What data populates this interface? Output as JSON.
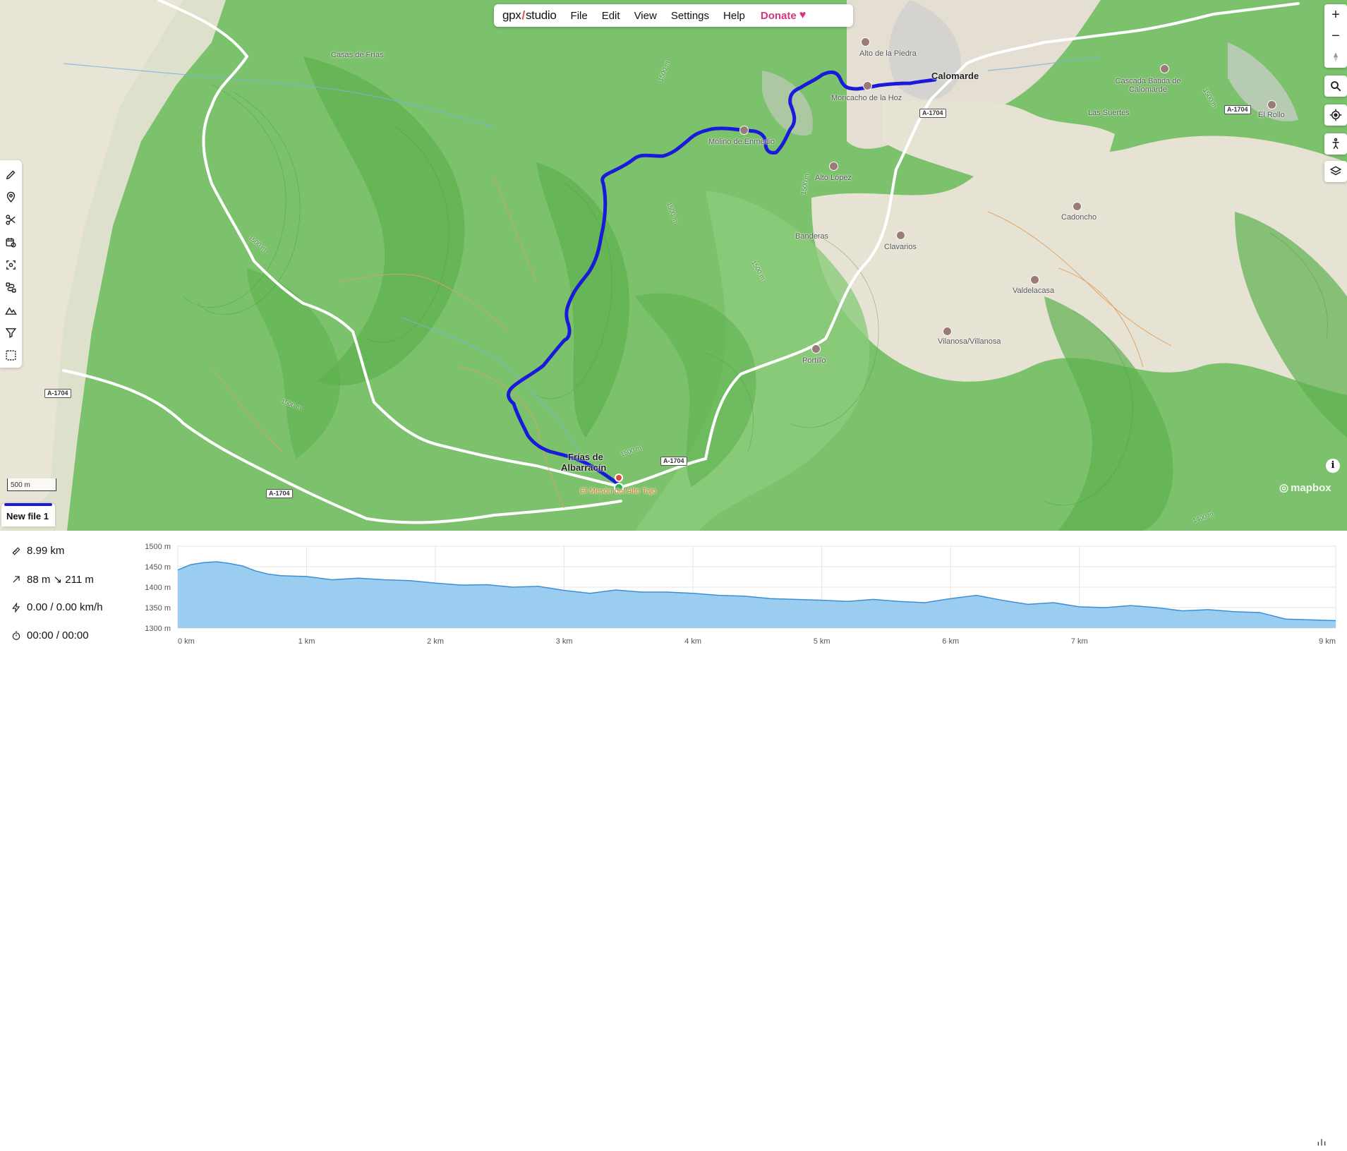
{
  "app": {
    "logo_left": "gpx",
    "logo_slash": "/",
    "logo_right": "studio"
  },
  "menu": {
    "file": "File",
    "edit": "Edit",
    "view": "View",
    "settings": "Settings",
    "help": "Help",
    "donate": "Donate"
  },
  "map": {
    "scale_label": "500 m",
    "attribution": "mapbox",
    "info": "i",
    "places": {
      "casas_de_frias": "Casas de Frías",
      "alto_de_la_piedra": "Alto de la Piedra",
      "calomarde": "Calomarde",
      "moricacho": "Moricacho de la Hoz",
      "molino": "Molino de Enmedio",
      "alto_lopez": "Alto López",
      "banderas": "Banderas",
      "clavarios": "Clavarios",
      "cascada": "Cascada Batida de Calomarde",
      "las_suertes": "Las Suertes",
      "el_rollo": "El Rollo",
      "cadoncho": "Cadoncho",
      "valdelacasa": "Valdelacasa",
      "vilanosa": "Vilanosa/Villanosa",
      "portillo": "Portillo",
      "frias_line1": "Frías de",
      "frias_line2": "Albarracín",
      "meson": "El Mesón del Alto Tajo"
    },
    "roads": {
      "r1": "A-1704",
      "r2": "A-1704",
      "r3": "A-1704",
      "r4": "A-1704",
      "r5": "A-1704"
    },
    "contours": {
      "c1": "1500 m",
      "c2": "1500 m",
      "c3": "1500 m",
      "c4": "1500 m",
      "c5": "1500 m",
      "c6": "1400 m",
      "c7": "1500 m",
      "c8": "1500 m",
      "c9": "1500 m"
    }
  },
  "file_tab": {
    "name": "New file 1",
    "color": "#1a1adb"
  },
  "stats": {
    "distance": "8.99 km",
    "elevation": "88 m ↘ 211 m",
    "speed": "0.00 / 0.00 km/h",
    "time": "00:00 / 00:00"
  },
  "chart_data": {
    "type": "area",
    "ylabel_ticks": [
      "1500 m",
      "1450 m",
      "1400 m",
      "1350 m",
      "1300 m"
    ],
    "xlabel_ticks": [
      "0 km",
      "1 km",
      "2 km",
      "3 km",
      "4 km",
      "5 km",
      "6 km",
      "7 km",
      "9 km"
    ],
    "ylim": [
      1300,
      1500
    ],
    "xlim": [
      0,
      8.99
    ],
    "x": [
      0,
      0.1,
      0.2,
      0.3,
      0.4,
      0.5,
      0.6,
      0.7,
      0.8,
      0.9,
      1.0,
      1.2,
      1.4,
      1.6,
      1.8,
      2.0,
      2.2,
      2.4,
      2.6,
      2.8,
      3.0,
      3.2,
      3.4,
      3.6,
      3.8,
      4.0,
      4.2,
      4.4,
      4.6,
      4.8,
      5.0,
      5.2,
      5.4,
      5.6,
      5.8,
      6.0,
      6.2,
      6.4,
      6.6,
      6.8,
      7.0,
      7.2,
      7.4,
      7.6,
      7.8,
      8.0,
      8.2,
      8.4,
      8.6,
      8.8,
      8.99
    ],
    "y": [
      1442,
      1455,
      1460,
      1462,
      1458,
      1452,
      1440,
      1432,
      1428,
      1427,
      1426,
      1418,
      1422,
      1418,
      1416,
      1410,
      1405,
      1406,
      1400,
      1402,
      1392,
      1385,
      1393,
      1388,
      1388,
      1385,
      1380,
      1378,
      1372,
      1370,
      1368,
      1365,
      1370,
      1365,
      1362,
      1372,
      1380,
      1368,
      1358,
      1362,
      1352,
      1350,
      1355,
      1350,
      1342,
      1345,
      1340,
      1338,
      1322,
      1320,
      1318
    ],
    "fill": "#9bcdf0",
    "stroke": "#3c8fd6"
  }
}
